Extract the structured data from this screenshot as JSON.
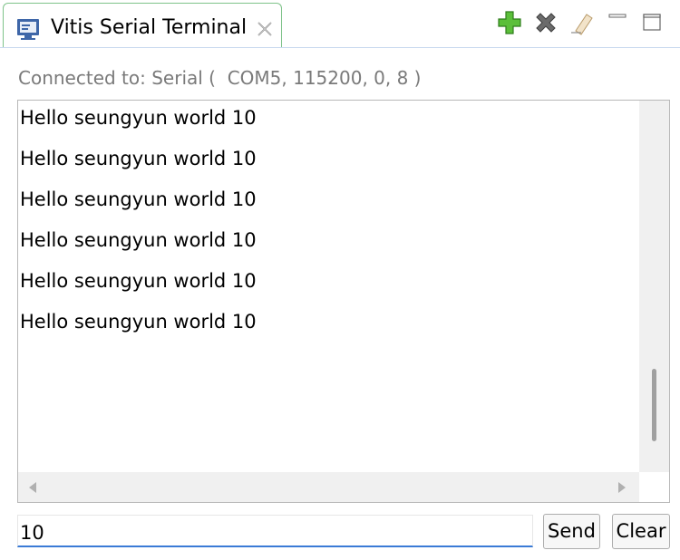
{
  "tab": {
    "title": "Vitis Serial Terminal",
    "icon": "terminal-icon",
    "close_icon": "close-icon"
  },
  "toolbar": {
    "buttons": [
      {
        "name": "add-icon",
        "color": "#4caf2f"
      },
      {
        "name": "remove-icon",
        "color": "#5a5a5a"
      },
      {
        "name": "eraser-icon",
        "color": "#d8b88a"
      },
      {
        "name": "minimize-icon",
        "color": "#666666"
      },
      {
        "name": "maximize-icon",
        "color": "#666666"
      }
    ]
  },
  "status": {
    "text": "Connected to: Serial (  COM5, 115200, 0, 8 )"
  },
  "console": {
    "lines": [
      "Hello seungyun world 10",
      "Hello seungyun world 10",
      "Hello seungyun world 10",
      "Hello seungyun world 10",
      "Hello seungyun world 10",
      "Hello seungyun world 10"
    ]
  },
  "input": {
    "value": "10"
  },
  "buttons": {
    "send": "Send",
    "clear": "Clear"
  },
  "colors": {
    "tab_border": "#7fc38a",
    "input_underline": "#3b7bd6",
    "status_text": "#7a7a7a"
  }
}
